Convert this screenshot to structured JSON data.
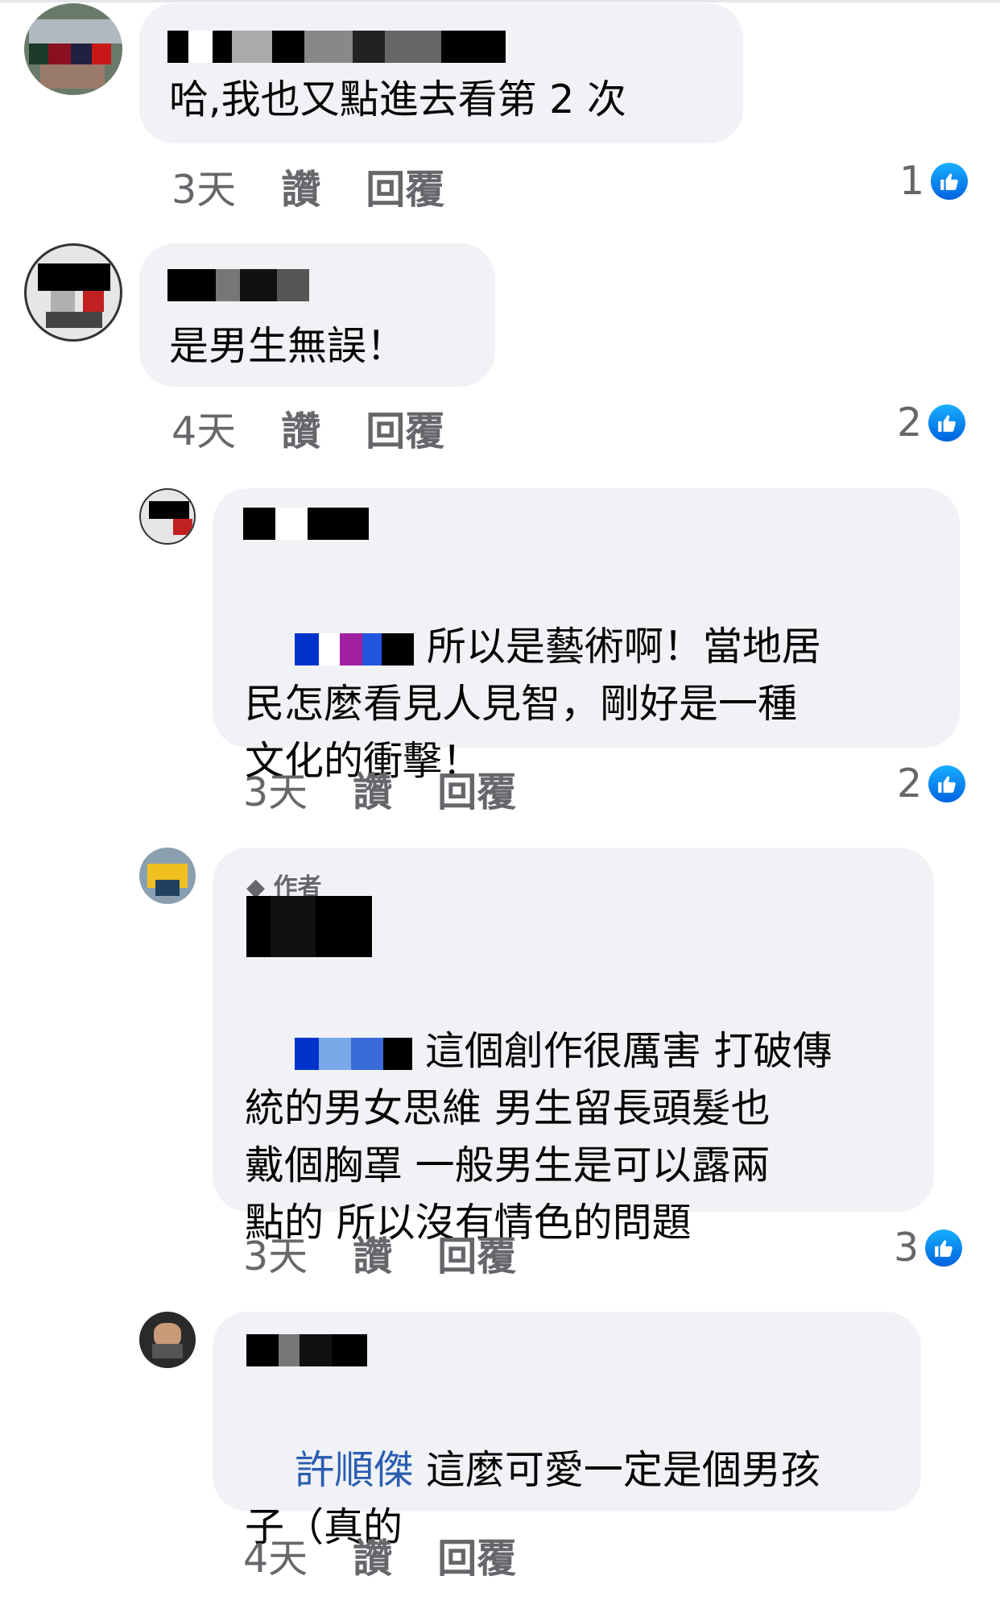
{
  "comments": [
    {
      "text": "哈,我也又點進去看第 2 次",
      "time": "3天",
      "like_label": "讚",
      "reply_label": "回覆",
      "reactions": "1"
    },
    {
      "text": "是男生無誤！",
      "time": "4天",
      "like_label": "讚",
      "reply_label": "回覆",
      "reactions": "2"
    },
    {
      "text": " 所以是藝術啊！當地居\n民怎麼看見人見智，剛好是一種\n文化的衝擊！",
      "time": "3天",
      "like_label": "讚",
      "reply_label": "回覆",
      "reactions": "2"
    },
    {
      "author_tag": "作者",
      "text": " 這個創作很厲害 打破傳\n統的男女思維 男生留長頭髮也\n戴個胸罩 一般男生是可以露兩\n點的 所以沒有情色的問題",
      "time": "3天",
      "like_label": "讚",
      "reply_label": "回覆",
      "reactions": "3"
    },
    {
      "mention": "許順傑",
      "text": " 這麼可愛一定是個男孩\n子（真的",
      "time": "4天",
      "like_label": "讚",
      "reply_label": "回覆"
    }
  ],
  "icons": {
    "like": "like-thumb-icon"
  },
  "colors": {
    "bubble": "#f0f2f5",
    "mention": "#2a5db0",
    "like_blue": "#1877f2",
    "meta": "#65676b"
  }
}
